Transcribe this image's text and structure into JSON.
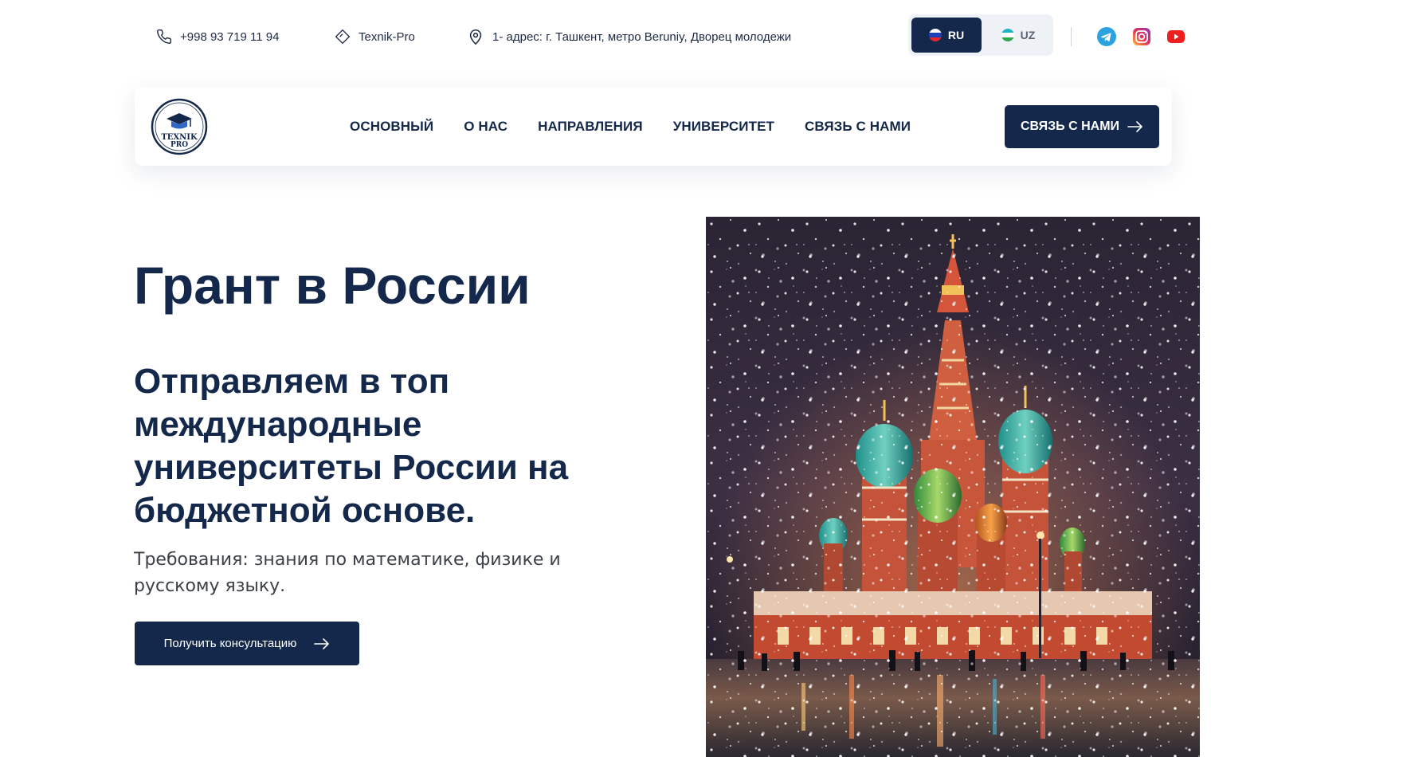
{
  "topbar": {
    "phone": "+998 93 719 11 94",
    "brand": "Texnik-Pro",
    "address": "1- адрес: г. Ташкент, метро Beruniy, Дворец молодежи",
    "languages": [
      {
        "code": "RU",
        "active": true
      },
      {
        "code": "UZ",
        "active": false
      }
    ],
    "social": [
      "telegram-icon",
      "instagram-icon",
      "youtube-icon"
    ]
  },
  "logo": {
    "line1": "TEXNIK",
    "line2": "PRO"
  },
  "nav": {
    "links": [
      "ОСНОВНЫЙ",
      "О НАС",
      "НАПРАВЛЕНИЯ",
      "УНИВЕРСИТЕТ",
      "СВЯЗЬ С НАМИ"
    ],
    "cta_label": "СВЯЗЬ С НАМИ"
  },
  "hero": {
    "title": "Грант в России",
    "subtitle": "Отправляем в топ международные университеты России на бюджетной основе.",
    "requirements": "Требования: знания по математике, физике и русскому языку.",
    "button_label": "Получить консультацию"
  },
  "colors": {
    "brand_navy": "#14284b",
    "telegram": "#2aa3df",
    "youtube": "#f01e1e",
    "instagram": "#d6249f"
  }
}
